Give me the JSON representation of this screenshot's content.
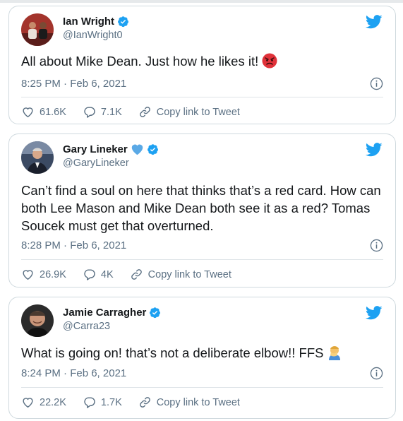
{
  "tweets": [
    {
      "name": "Ian Wright",
      "handle": "@IanWright0",
      "has_heart": false,
      "text": "All about Mike Dean. Just how he likes it!",
      "emoji": "pouting-face",
      "timestamp": "8:25 PM · Feb 6, 2021",
      "likes": "61.6K",
      "replies": "7.1K",
      "copy_label": "Copy link to Tweet"
    },
    {
      "name": "Gary Lineker",
      "handle": "@GaryLineker",
      "has_heart": true,
      "text": "Can’t find a soul on here that thinks that’s a red card. How can both Lee Mason and Mike Dean both see it as a red? Tomas Soucek must get that overturned.",
      "timestamp": "8:28 PM · Feb 6, 2021",
      "likes": "26.9K",
      "replies": "4K",
      "copy_label": "Copy link to Tweet"
    },
    {
      "name": "Jamie Carragher",
      "handle": "@Carra23",
      "has_heart": false,
      "text": "What is going on! that’s not a deliberate elbow!! FFS",
      "emoji": "person-facepalming",
      "timestamp": "8:24 PM · Feb 6, 2021",
      "likes": "22.2K",
      "replies": "1.7K",
      "copy_label": "Copy link to Tweet"
    }
  ],
  "colors": {
    "twitter_blue": "#1da1f2",
    "secondary_text": "#5b7083",
    "border": "#cfd9de"
  }
}
